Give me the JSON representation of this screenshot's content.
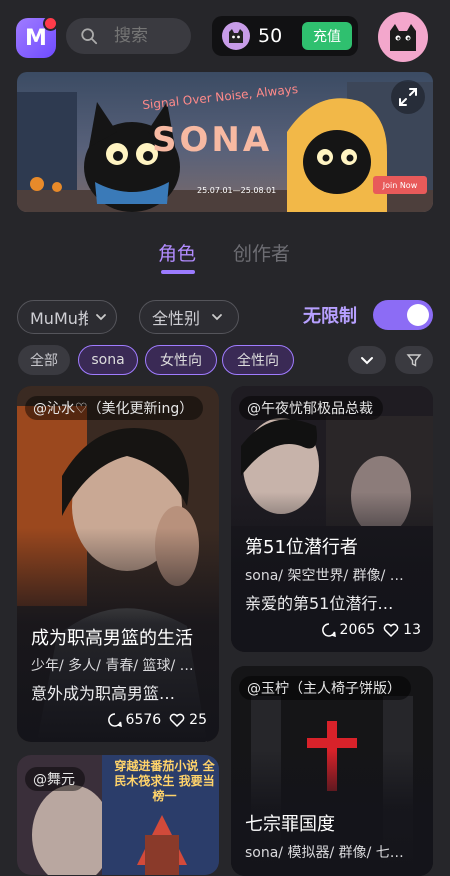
{
  "header": {
    "logo_letter": "M",
    "search_placeholder": "搜索",
    "coin_balance": "50",
    "recharge_label": "充值"
  },
  "banner": {
    "slogan": "Signal Over Noise, Always",
    "title": "SONA",
    "dates": "25.07.01—25.08.01",
    "join_label": "Join Now"
  },
  "tabs": [
    {
      "label": "角色",
      "active": true
    },
    {
      "label": "创作者",
      "active": false
    }
  ],
  "filters": {
    "sort_value": "MuMu推荐",
    "gender_value": "全性别",
    "no_limit_label": "无限制",
    "no_limit_on": true,
    "chips": [
      {
        "label": "全部",
        "selected": false
      },
      {
        "label": "sona",
        "selected": true
      },
      {
        "label": "女性向",
        "selected": true
      },
      {
        "label": "全性向",
        "selected": true
      }
    ]
  },
  "cards": [
    {
      "author": "@沁水♡（美化更新ing）",
      "title": "成为职高男篮的生活",
      "tags": "少年/ 多人/ 青春/ 篮球/ …",
      "desc": "意外成为职高男篮…",
      "likes": "6576",
      "hearts": "25"
    },
    {
      "author": "@午夜忧郁极品总裁",
      "title": "第51位潜行者",
      "tags": "sona/ 架空世界/ 群像/ …",
      "desc": "亲爱的第51位潜行…",
      "likes": "2065",
      "hearts": "13"
    },
    {
      "author": "@舞元",
      "poster_text": "穿越进番茄小说 全民木筏求生 我要当榜一",
      "title": "",
      "tags": "",
      "desc": "",
      "likes": "",
      "hearts": ""
    },
    {
      "author": "@玉柠（主人椅子饼版）",
      "title": "七宗罪国度",
      "tags": "sona/ 模拟器/ 群像/ 七…",
      "desc": "",
      "likes": "",
      "hearts": ""
    }
  ],
  "colors": {
    "accent": "#9b7bff",
    "background": "#26262a",
    "recharge": "#2fc06f"
  }
}
